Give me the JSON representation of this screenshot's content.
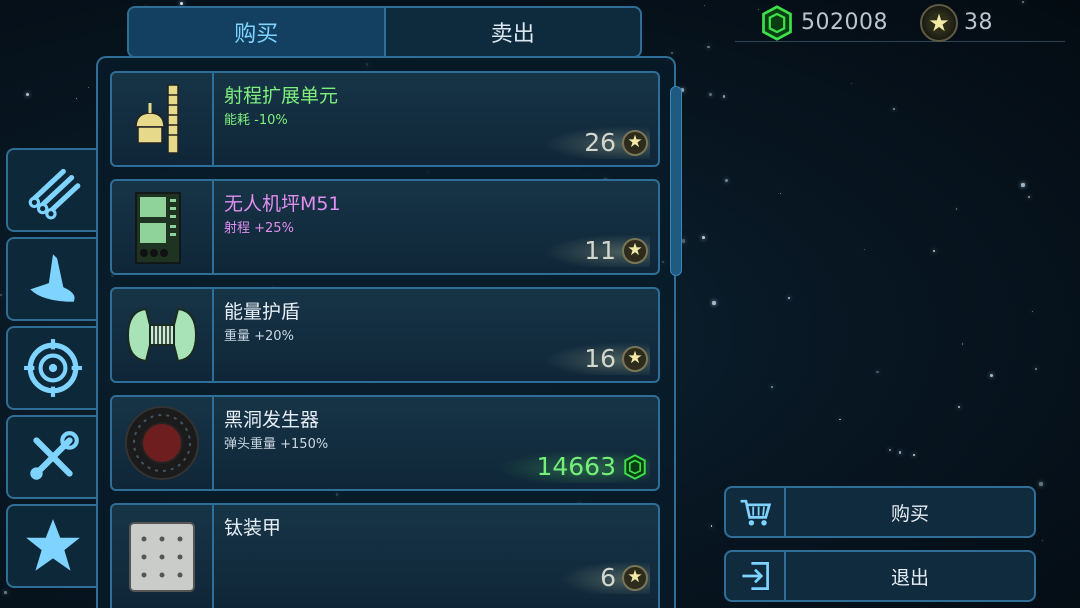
{
  "currency": {
    "gems": "502008",
    "stars": "38"
  },
  "tabs": [
    {
      "label": "购买",
      "active": true
    },
    {
      "label": "卖出",
      "active": false
    }
  ],
  "categories": [
    "pipes-icon",
    "wing-icon",
    "target-icon",
    "tools-icon",
    "star-icon"
  ],
  "items": [
    {
      "name": "射程扩展单元",
      "stat": "能耗 -10%",
      "price": "26",
      "currency": "star",
      "name_color": "#7ef07c",
      "stat_color": "#7ef07c",
      "icon": "range-extender-icon"
    },
    {
      "name": "无人机坪M51",
      "stat": "射程 +25%",
      "price": "11",
      "currency": "star",
      "name_color": "#e08ef0",
      "stat_color": "#e08ef0",
      "icon": "drone-pad-icon"
    },
    {
      "name": "能量护盾",
      "stat": "重量 +20%",
      "price": "16",
      "currency": "star",
      "name_color": "#e6eef5",
      "stat_color": "#c9d7e2",
      "icon": "energy-shield-icon"
    },
    {
      "name": "黑洞发生器",
      "stat": "弹头重量 +150%",
      "price": "14663",
      "currency": "gem",
      "name_color": "#e6eef5",
      "stat_color": "#c9d7e2",
      "icon": "black-hole-icon"
    },
    {
      "name": "钛装甲",
      "stat": "",
      "price": "6",
      "currency": "star",
      "name_color": "#e6eef5",
      "stat_color": "#c9d7e2",
      "icon": "titanium-armor-icon"
    }
  ],
  "actions": {
    "buy_label": "购买",
    "exit_label": "退出"
  },
  "colors": {
    "accent_border": "#2f6e96",
    "gem_green": "#3de04a",
    "star_gold": "#f2e9a6"
  }
}
